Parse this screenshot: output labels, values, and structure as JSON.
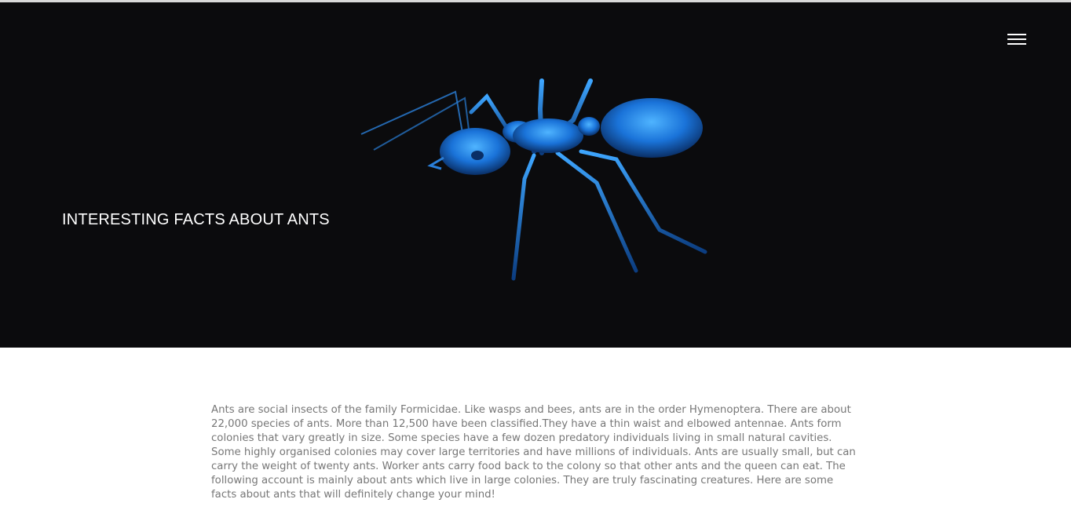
{
  "hero": {
    "title": "INTERESTING FACTS ABOUT ANTS",
    "menu_icon": "hamburger-menu-icon",
    "image": "blue-x-ray-ant-illustration",
    "background_color": "#0b0b0d",
    "accent_color": "#1e88ff"
  },
  "content": {
    "intro": "Ants are social insects of the family Formicidae. Like wasps and bees, ants are in the order Hymenoptera. There are about 22,000 species of ants. More than 12,500 have been classified.They have a thin waist and elbowed antennae. Ants form colonies that vary greatly in size. Some species have a few dozen predatory individuals living in small natural cavities. Some highly organised colonies may cover large territories and have millions of individuals. Ants are usually small, but can carry the weight of twenty ants. Worker ants carry food back to the colony so that other ants and the queen can eat. The following account is mainly about ants which live in large colonies. They are truly fascinating creatures. Here are some facts about ants that will definitely change your mind!",
    "text_color": "#777777"
  }
}
